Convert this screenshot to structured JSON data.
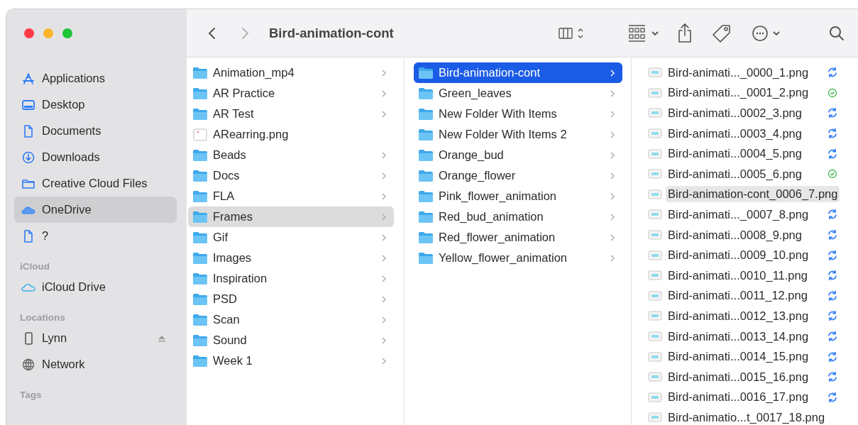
{
  "window": {
    "title": "Bird-animation-cont",
    "forward": {
      "disabled": true
    }
  },
  "sidebar": {
    "sections": [
      {
        "items": [
          {
            "kind": "apps",
            "label": "Applications",
            "selected": false,
            "ejectable": false
          },
          {
            "kind": "desktop",
            "label": "Desktop",
            "selected": false,
            "ejectable": false
          },
          {
            "kind": "document",
            "label": "Documents",
            "selected": false,
            "ejectable": false
          },
          {
            "kind": "download",
            "label": "Downloads",
            "selected": false,
            "ejectable": false
          },
          {
            "kind": "folder",
            "label": "Creative Cloud Files",
            "selected": false,
            "ejectable": false
          },
          {
            "kind": "onedrive",
            "label": "OneDrive",
            "selected": true,
            "ejectable": false
          },
          {
            "kind": "document",
            "label": "?",
            "selected": false,
            "ejectable": false
          }
        ]
      },
      {
        "title": "iCloud",
        "items": [
          {
            "kind": "icloud",
            "label": "iCloud Drive",
            "selected": false,
            "ejectable": false
          }
        ]
      },
      {
        "title": "Locations",
        "items": [
          {
            "kind": "phone",
            "label": "Lynn",
            "selected": false,
            "ejectable": true
          },
          {
            "kind": "network",
            "label": "Network",
            "selected": false,
            "ejectable": false
          }
        ]
      },
      {
        "title": "Tags"
      }
    ]
  },
  "columns": [
    {
      "items": [
        {
          "kind": "folder",
          "name": "Animation_mp4",
          "selected": false
        },
        {
          "kind": "folder",
          "name": "AR Practice",
          "selected": false
        },
        {
          "kind": "folder",
          "name": "AR Test",
          "selected": false
        },
        {
          "kind": "image",
          "name": "ARearring.png",
          "selected": false
        },
        {
          "kind": "folder",
          "name": "Beads",
          "selected": false
        },
        {
          "kind": "folder",
          "name": "Docs",
          "selected": false
        },
        {
          "kind": "folder",
          "name": "FLA",
          "selected": false
        },
        {
          "kind": "folder",
          "name": "Frames",
          "selected": true
        },
        {
          "kind": "folder",
          "name": "Gif",
          "selected": false
        },
        {
          "kind": "folder",
          "name": "Images",
          "selected": false
        },
        {
          "kind": "folder",
          "name": "Inspiration",
          "selected": false
        },
        {
          "kind": "folder",
          "name": "PSD",
          "selected": false
        },
        {
          "kind": "folder",
          "name": "Scan",
          "selected": false
        },
        {
          "kind": "folder",
          "name": "Sound",
          "selected": false
        },
        {
          "kind": "folder",
          "name": "Week 1",
          "selected": false
        }
      ]
    },
    {
      "focused": true,
      "items": [
        {
          "kind": "folder",
          "name": "Bird-animation-cont",
          "selected": true
        },
        {
          "kind": "folder",
          "name": "Green_leaves",
          "selected": false
        },
        {
          "kind": "folder",
          "name": "New Folder With Items",
          "selected": false
        },
        {
          "kind": "folder",
          "name": "New Folder With Items 2",
          "selected": false
        },
        {
          "kind": "folder",
          "name": "Orange_bud",
          "selected": false
        },
        {
          "kind": "folder",
          "name": "Orange_flower",
          "selected": false
        },
        {
          "kind": "folder",
          "name": "Pink_flower_animation",
          "selected": false
        },
        {
          "kind": "folder",
          "name": "Red_bud_animation",
          "selected": false
        },
        {
          "kind": "folder",
          "name": "Red_flower_animation",
          "selected": false
        },
        {
          "kind": "folder",
          "name": "Yellow_flower_animation",
          "selected": false
        }
      ]
    }
  ],
  "files": [
    {
      "name": "Bird-animati..._0000_1.png",
      "kind": "syncing",
      "expanded": false
    },
    {
      "name": "Bird-animati..._0001_2.png",
      "kind": "synced",
      "expanded": false
    },
    {
      "name": "Bird-animati...0002_3.png",
      "kind": "syncing",
      "expanded": false
    },
    {
      "name": "Bird-animati...0003_4.png",
      "kind": "syncing",
      "expanded": false
    },
    {
      "name": "Bird-animati...0004_5.png",
      "kind": "syncing",
      "expanded": false
    },
    {
      "name": "Bird-animati...0005_6.png",
      "kind": "synced",
      "expanded": false
    },
    {
      "name": "Bird-animation-cont_0006_7.png",
      "kind": "plain",
      "expanded": true
    },
    {
      "name": "Bird-animati..._0007_8.png",
      "kind": "syncing",
      "expanded": false
    },
    {
      "name": "Bird-animati...0008_9.png",
      "kind": "syncing",
      "expanded": false
    },
    {
      "name": "Bird-animati...0009_10.png",
      "kind": "syncing",
      "expanded": false
    },
    {
      "name": "Bird-animati...0010_11.png",
      "kind": "syncing",
      "expanded": false
    },
    {
      "name": "Bird-animati...0011_12.png",
      "kind": "syncing",
      "expanded": false
    },
    {
      "name": "Bird-animati...0012_13.png",
      "kind": "syncing",
      "expanded": false
    },
    {
      "name": "Bird-animati...0013_14.png",
      "kind": "syncing",
      "expanded": false
    },
    {
      "name": "Bird-animati...0014_15.png",
      "kind": "syncing",
      "expanded": false
    },
    {
      "name": "Bird-animati...0015_16.png",
      "kind": "syncing",
      "expanded": false
    },
    {
      "name": "Bird-animati...0016_17.png",
      "kind": "syncing",
      "expanded": false
    },
    {
      "name": "Bird-animatio...t_0017_18.png",
      "kind": "plain",
      "expanded": false
    }
  ]
}
